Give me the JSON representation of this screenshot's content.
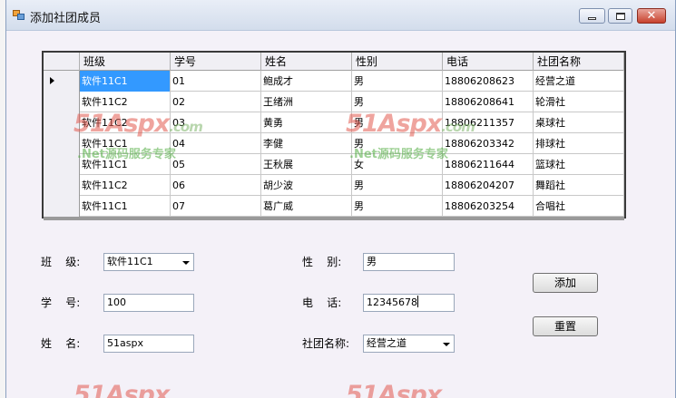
{
  "window": {
    "title": "添加社团成员"
  },
  "grid": {
    "columns": [
      "班级",
      "学号",
      "姓名",
      "性别",
      "电话",
      "社团名称"
    ],
    "rows": [
      [
        "软件11C1",
        "01",
        "鲍成才",
        "男",
        "18806208623",
        "经营之道"
      ],
      [
        "软件11C2",
        "02",
        "王绪洲",
        "男",
        "18806208641",
        "轮滑社"
      ],
      [
        "软件11C2",
        "03",
        "黄勇",
        "男",
        "18806211357",
        "桌球社"
      ],
      [
        "软件11C1",
        "04",
        "李健",
        "男",
        "18806203342",
        "排球社"
      ],
      [
        "软件11C1",
        "05",
        "王秋展",
        "女",
        "18806211644",
        "篮球社"
      ],
      [
        "软件11C2",
        "06",
        "胡少波",
        "男",
        "18806204207",
        "舞蹈社"
      ],
      [
        "软件11C1",
        "07",
        "葛广威",
        "男",
        "18806203254",
        "合唱社"
      ]
    ]
  },
  "watermark": {
    "logo": "51Aspx",
    "domain": ".com",
    "slogan": ".Net源码服务专家"
  },
  "form": {
    "class_label": "班    级:",
    "class_value": "软件11C1",
    "id_label": "学    号:",
    "id_value": "100",
    "name_label": "姓    名:",
    "name_value": "51aspx",
    "gender_label": "性    别:",
    "gender_value": "男",
    "phone_label": "电    话:",
    "phone_value": "12345678",
    "club_label": "社团名称:",
    "club_value": "经营之道",
    "add_label": "添加",
    "reset_label": "重置"
  }
}
